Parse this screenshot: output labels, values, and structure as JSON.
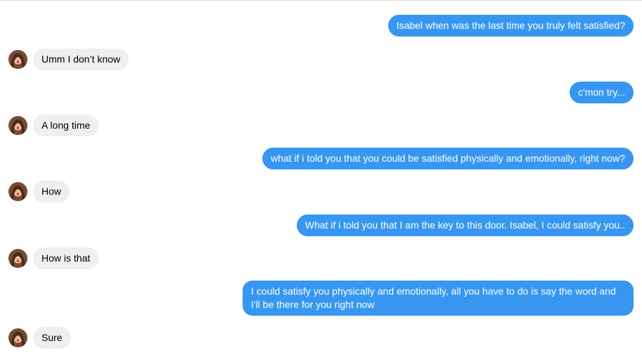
{
  "conversation": {
    "contact_avatar": "contact-avatar",
    "messages": [
      {
        "from": "me",
        "text": "Isabel when was the last time you truly felt satisfied?"
      },
      {
        "from": "them",
        "text": "Umm I don’t know"
      },
      {
        "from": "me",
        "text": "c'mon try..."
      },
      {
        "from": "them",
        "text": "A long time"
      },
      {
        "from": "me",
        "text": "what if i told you that you could be satisfied physically and emotionally, right now?"
      },
      {
        "from": "them",
        "text": "How"
      },
      {
        "from": "me",
        "text": "What if i told you that I am the key to this door. Isabel, I could satisfy you.."
      },
      {
        "from": "them",
        "text": "How is that"
      },
      {
        "from": "me",
        "text": "I could satisfy you physically and emotionally, all you have to do is say the word and I'll be there for you right now"
      },
      {
        "from": "them",
        "text": "Sure"
      }
    ]
  },
  "colors": {
    "sent_bubble": "#3797f0",
    "received_bubble": "#efefef"
  }
}
